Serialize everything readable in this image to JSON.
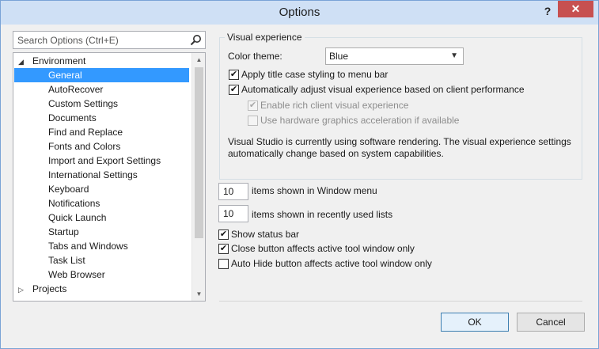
{
  "window": {
    "title": "Options",
    "help_glyph": "?",
    "close_glyph": "✕"
  },
  "search": {
    "placeholder": "Search Options (Ctrl+E)"
  },
  "tree": {
    "environment": "Environment",
    "children": [
      "General",
      "AutoRecover",
      "Custom Settings",
      "Documents",
      "Find and Replace",
      "Fonts and Colors",
      "Import and Export Settings",
      "International Settings",
      "Keyboard",
      "Notifications",
      "Quick Launch",
      "Startup",
      "Tabs and Windows",
      "Task List",
      "Web Browser"
    ],
    "selected": "General",
    "projects": "Projects",
    "expanded_glyph": "◢",
    "collapsed_glyph": "▷"
  },
  "visual_experience": {
    "legend": "Visual experience",
    "color_theme_label": "Color theme:",
    "color_theme_value": "Blue",
    "apply_title_case": "Apply title case styling to menu bar",
    "auto_adjust": "Automatically adjust visual experience based on client performance",
    "rich_client": "Enable rich client visual experience",
    "hw_accel": "Use hardware graphics acceleration if available",
    "info_line1": "Visual Studio is currently using software rendering.  The visual experience settings",
    "info_line2": "automatically change based on system capabilities."
  },
  "window_menu": {
    "count": "10",
    "label": "items shown in Window menu"
  },
  "recent_lists": {
    "count": "10",
    "label": "items shown in recently used lists"
  },
  "status_bar": {
    "show_status_bar": "Show status bar",
    "close_button": "Close button affects active tool window only",
    "auto_hide": "Auto Hide button affects active tool window only"
  },
  "buttons": {
    "ok": "OK",
    "cancel": "Cancel"
  },
  "check_glyph": "✔",
  "colors": {
    "selection": "#3399ff",
    "close_button": "#c75050",
    "titlebar": "#cfe0f5"
  }
}
